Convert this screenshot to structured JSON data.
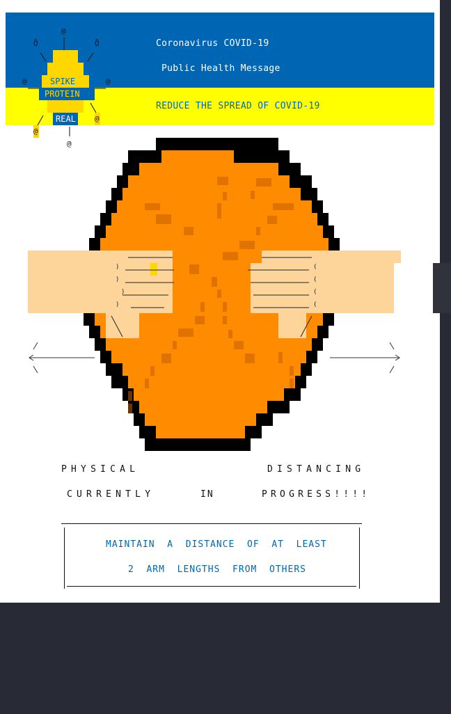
{
  "header": {
    "title": "Coronavirus COVID-19",
    "subtitle": "Public Health Message",
    "slogan": "REDUCE THE SPREAD OF COVID-19"
  },
  "virus": {
    "line1": "SPIKE",
    "line2": "PROTEIN",
    "line3": "REAL",
    "spike": "@",
    "tip": "Õ"
  },
  "message": {
    "line1_left": "PHYSICAL",
    "line1_right": "DISTANCING",
    "line2_left": "CURRENTLY",
    "line2_mid": "IN",
    "line2_right": "PROGRESS!!!!"
  },
  "notice": {
    "line1": "MAINTAIN  A  DISTANCE  OF  AT  LEAST",
    "line2": "2  ARM  LENGTHS  FROM  OTHERS"
  },
  "colors": {
    "blue": "#0066b3",
    "yellow": "#ffff00",
    "orange": "#ff8c00",
    "skin": "#fdd59b",
    "virus_yellow": "#ffd700"
  }
}
